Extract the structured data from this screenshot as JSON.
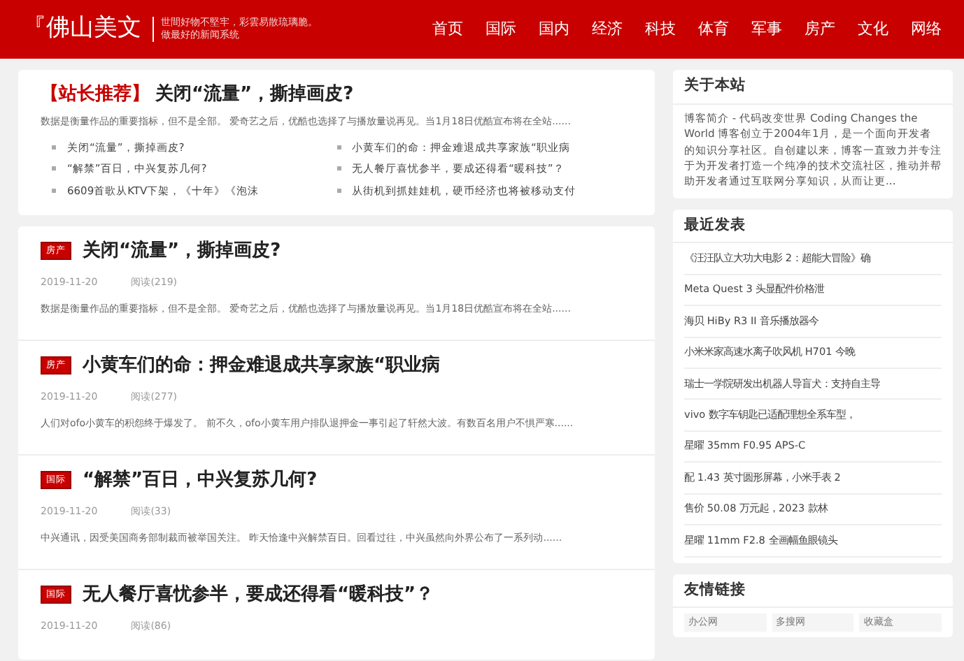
{
  "header": {
    "logo": "『佛山美文",
    "slogan": [
      "世間好物不堅牢，彩雲易散琉璃脆。",
      "做最好的新闻系统"
    ],
    "nav": [
      "首页",
      "国际",
      "国内",
      "经济",
      "科技",
      "体育",
      "军事",
      "房产",
      "文化",
      "网络"
    ]
  },
  "featured": {
    "tag": "【站长推荐】",
    "title": "关闭“流量”，撕掉画皮?",
    "summary": "数据是衡量作品的重要指标，但不是全部。 爱奇艺之后，优酷也选择了与播放量说再见。当1月18日优酷宣布将在全站......",
    "links": [
      "关闭“流量”，撕掉画皮?",
      "小黄车们的命：押金难退成共享家族“职业病",
      "“解禁”百日，中兴复苏几何?",
      "无人餐厅喜忧参半，要成还得看“暖科技”？",
      "6609首歌从KTV下架，《十年》《泡沫",
      "从街机到抓娃娃机，硬币经济也将被移动支付"
    ]
  },
  "articles": [
    {
      "category": "房产",
      "title": "关闭“流量”，撕掉画皮?",
      "date": "2019-11-20",
      "views": "阅读(219)",
      "summary": "数据是衡量作品的重要指标，但不是全部。 爱奇艺之后，优酷也选择了与播放量说再见。当1月18日优酷宣布将在全站......"
    },
    {
      "category": "房产",
      "title": "小黄车们的命：押金难退成共享家族“职业病",
      "date": "2019-11-20",
      "views": "阅读(277)",
      "summary": "人们对ofo小黄车的积怨终于爆发了。 前不久，ofo小黄车用户排队退押金一事引起了轩然大波。有数百名用户不惧严寒......"
    },
    {
      "category": "国际",
      "title": "“解禁”百日，中兴复苏几何?",
      "date": "2019-11-20",
      "views": "阅读(33)",
      "summary": "中兴通讯，因受美国商务部制裁而被举国关注。 昨天恰逢中兴解禁百日。回看过往，中兴虽然向外界公布了一系列动......"
    },
    {
      "category": "国际",
      "title": "无人餐厅喜忧参半，要成还得看“暖科技”？",
      "date": "2019-11-20",
      "views": "阅读(86)"
    }
  ],
  "sidebar": {
    "about": {
      "title": "关于本站",
      "text": "博客简介 - 代码改变世界 Coding Changes the World 博客创立于2004年1月，是一个面向开发者的知识分享社区。自创建以来，博客一直致力并专注于为开发者打造一个纯净的技术交流社区，推动并帮助开发者通过互联网分享知识，从而让更..."
    },
    "recent": {
      "title": "最近发表",
      "items": [
        "《汪汪队立大功大电影 2：超能大冒险》确",
        "Meta Quest 3 头显配件价格泄",
        "海贝 HiBy R3 II 音乐播放器今",
        "小米米家高速水离子吹风机 H701 今晚",
        "瑞士一学院研发出机器人导盲犬：支持自主导",
        "vivo 数字车钥匙已适配理想全系车型，",
        "星曜 35mm F0.95 APS-C",
        "配 1.43 英寸圆形屏幕，小米手表 2",
        "售价 50.08 万元起，2023 款林",
        "星曜 11mm F2.8 全画幅鱼眼镜头"
      ]
    },
    "links": {
      "title": "友情链接",
      "items": [
        "办公网",
        "多搜网",
        "收藏盒"
      ]
    }
  }
}
